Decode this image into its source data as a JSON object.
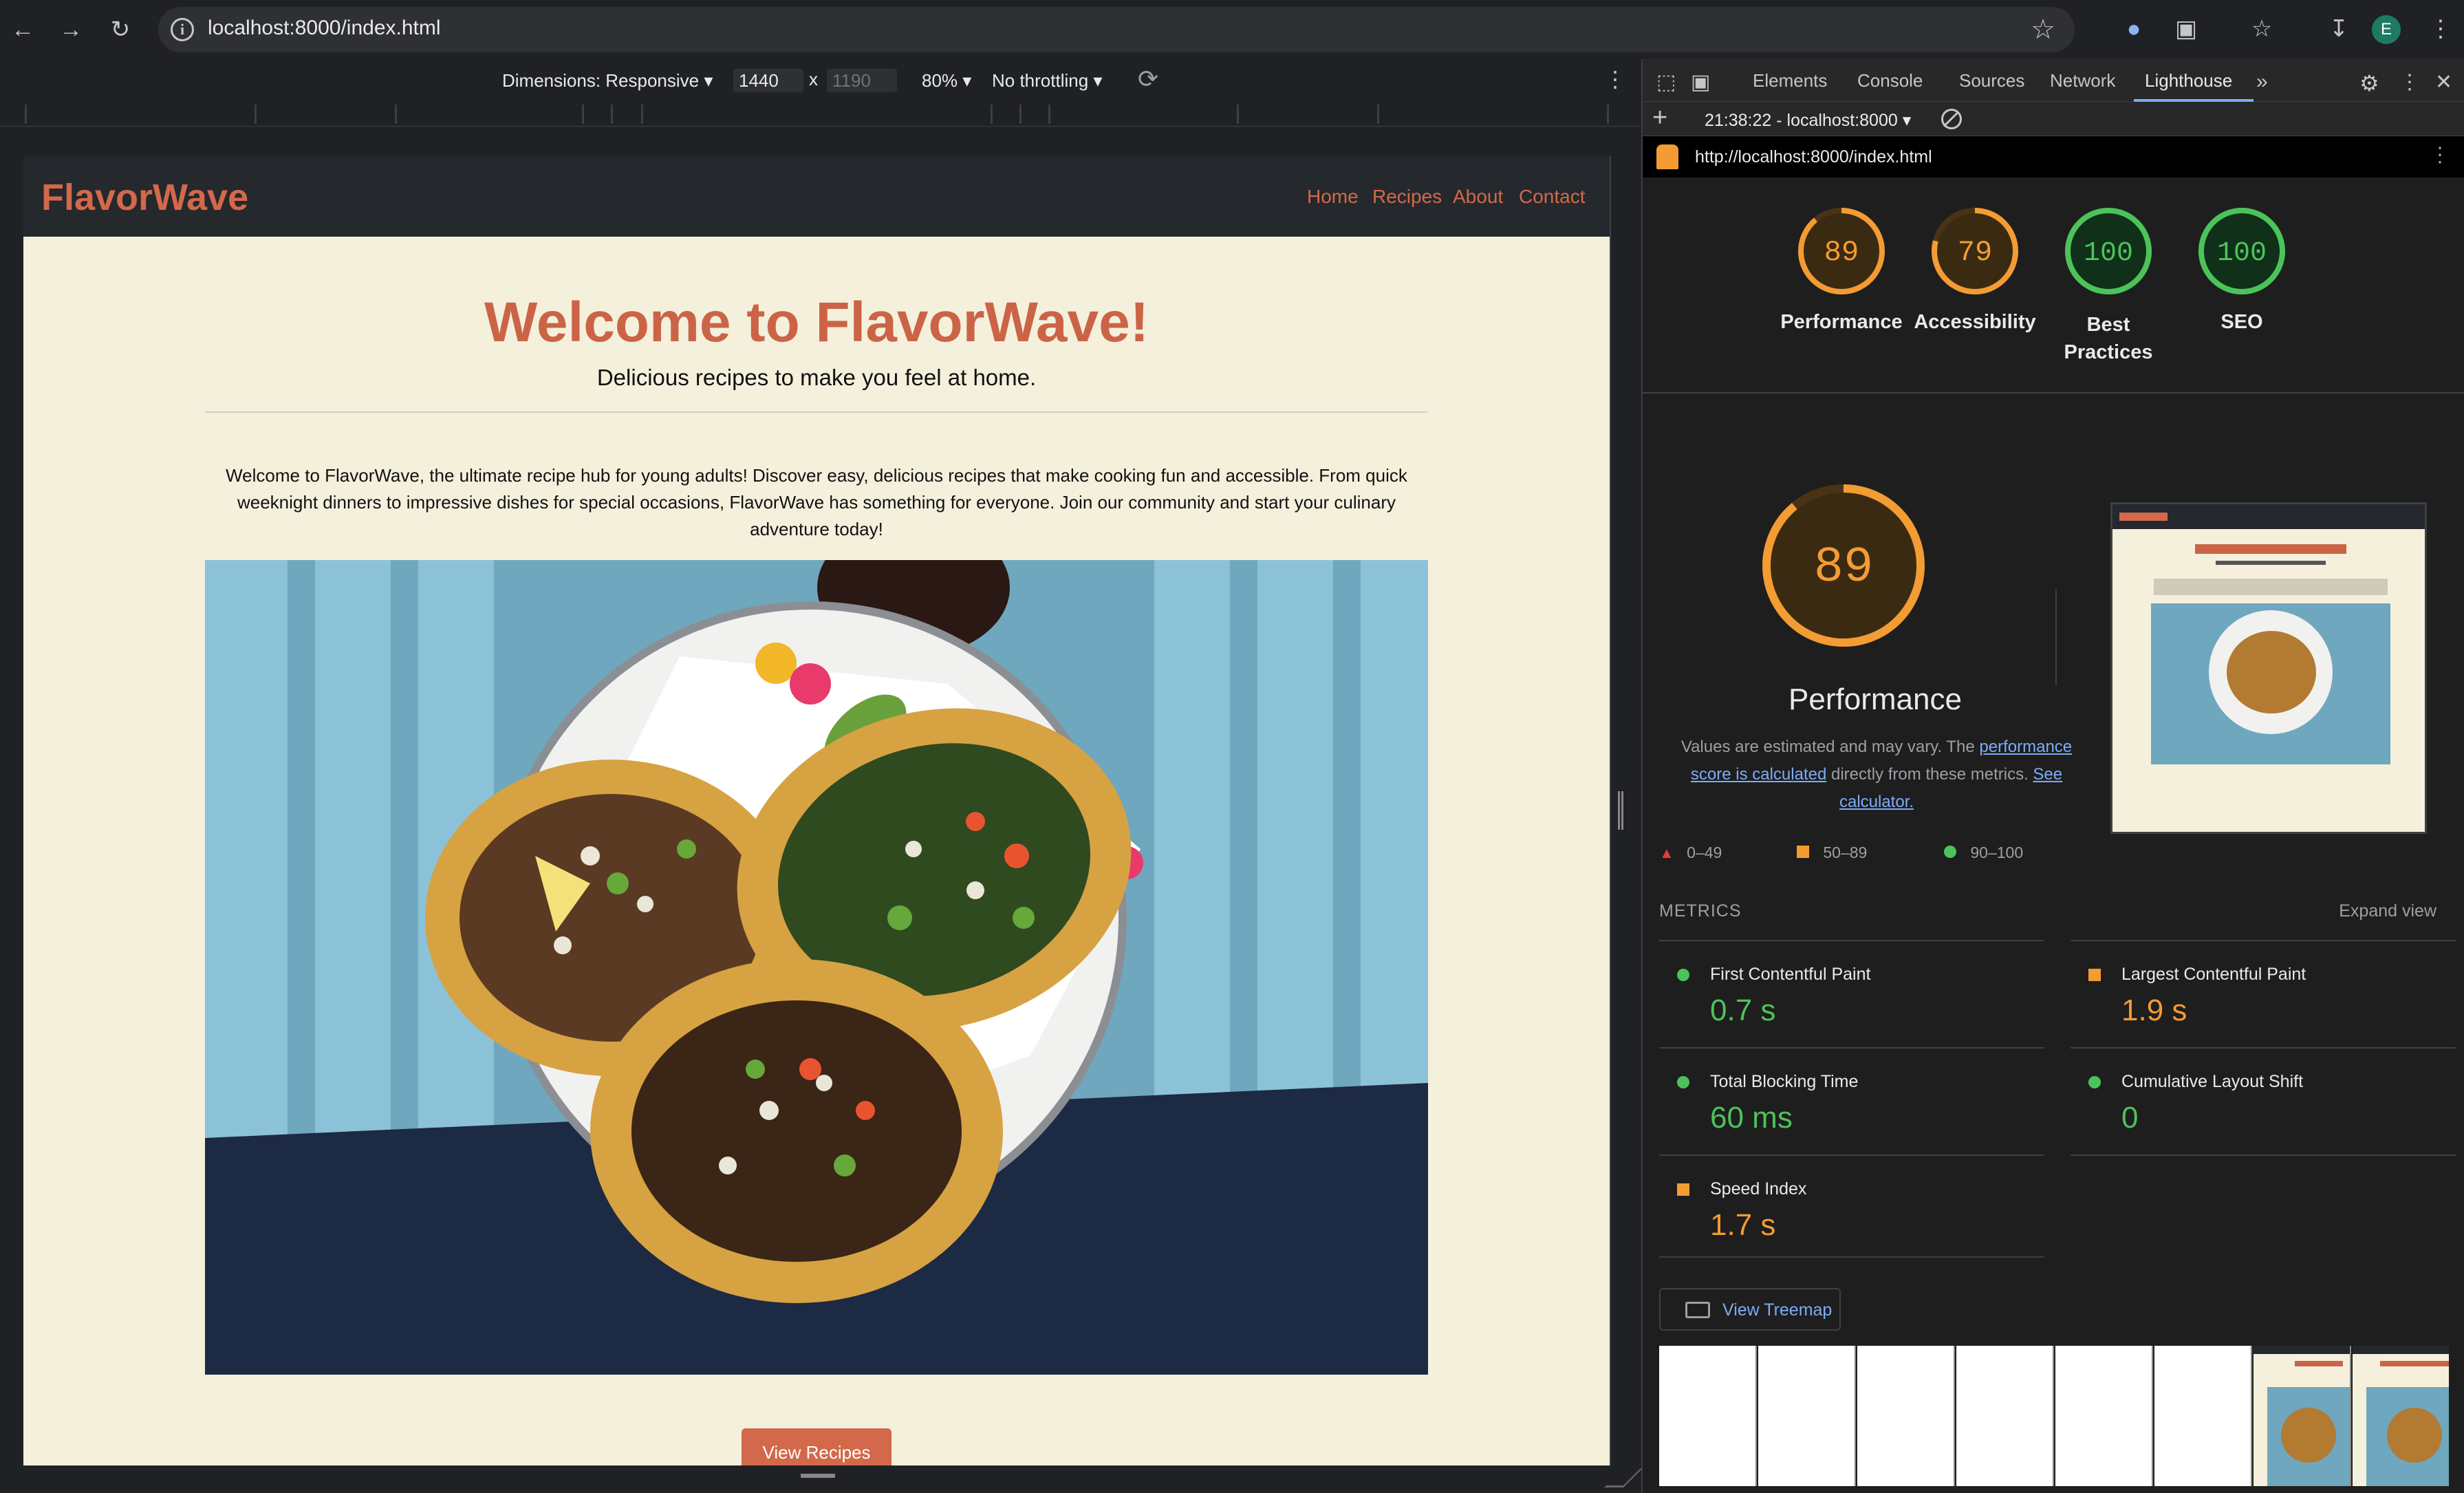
{
  "browser": {
    "url": "localhost:8000/index.html",
    "avatar_letter": "E"
  },
  "device_toolbar": {
    "dimensions_label": "Dimensions: Responsive",
    "width": "1440",
    "times": "x",
    "height": "1190",
    "zoom": "80%",
    "throttling": "No throttling"
  },
  "site": {
    "logo": "FlavorWave",
    "nav": [
      "Home",
      "Recipes",
      "About",
      "Contact"
    ],
    "hero_title": "Welcome to FlavorWave!",
    "hero_subtitle": "Delicious recipes to make you feel at home.",
    "intro": "Welcome to FlavorWave, the ultimate recipe hub for young adults! Discover easy, delicious recipes that make cooking fun and accessible. From quick weeknight dinners to impressive dishes for special occasions, FlavorWave has something for everyone. Join our community and start your culinary adventure today!",
    "cta_button": "View Recipes"
  },
  "devtools": {
    "tabs": [
      "Elements",
      "Console",
      "Sources",
      "Network",
      "Lighthouse"
    ],
    "active_tab": "Lighthouse",
    "report_selector": "21:38:22 - localhost:8000",
    "report_url": "http://localhost:8000/index.html"
  },
  "lighthouse": {
    "scores": [
      {
        "value": 89,
        "label": "Performance",
        "color": "#f39c33"
      },
      {
        "value": 79,
        "label": "Accessibility",
        "color": "#f39c33"
      },
      {
        "value": 100,
        "label": "Best Practices",
        "color": "#4cc35a"
      },
      {
        "value": 100,
        "label": "SEO",
        "color": "#4cc35a"
      }
    ],
    "performance": {
      "score": 89,
      "title": "Performance",
      "desc_1": "Values are estimated and may vary. The",
      "desc_link": "performance score is calculated",
      "desc_2": "directly from these metrics.",
      "calc_link": "See calculator."
    },
    "legend": [
      "0–49",
      "50–89",
      "90–100"
    ],
    "metrics_header": "METRICS",
    "expand_view": "Expand view",
    "metrics": [
      {
        "label": "First Contentful Paint",
        "value": "0.7 s",
        "status": "good"
      },
      {
        "label": "Largest Contentful Paint",
        "value": "1.9 s",
        "status": "average"
      },
      {
        "label": "Total Blocking Time",
        "value": "60 ms",
        "status": "good"
      },
      {
        "label": "Cumulative Layout Shift",
        "value": "0",
        "status": "good"
      },
      {
        "label": "Speed Index",
        "value": "1.7 s",
        "status": "average"
      }
    ],
    "treemap_button": "View Treemap",
    "colors": {
      "good": "#4cc35a",
      "average": "#f39c33",
      "fail": "#e53935"
    }
  }
}
